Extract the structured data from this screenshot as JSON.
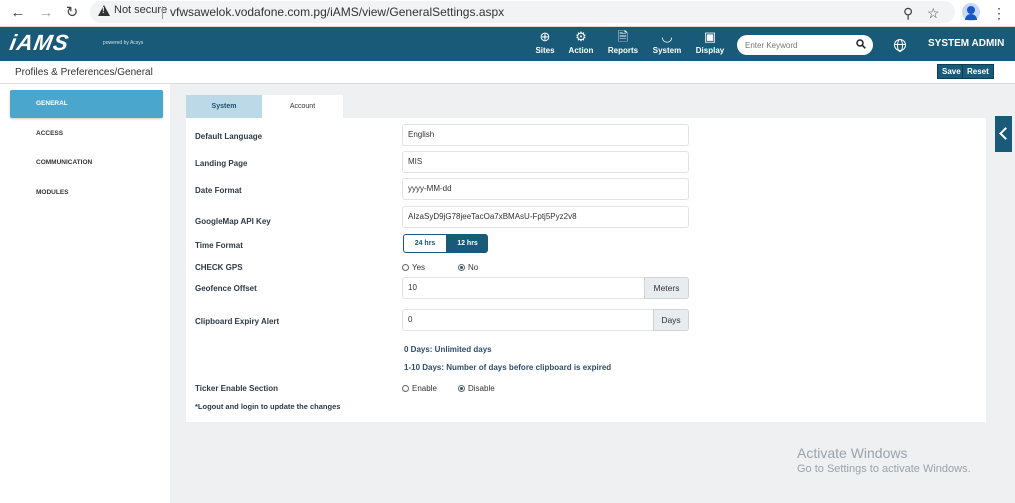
{
  "browser": {
    "security_label": "Not secure",
    "url": "vfwsawelok.vodafone.com.pg/iAMS/view/GeneralSettings.aspx"
  },
  "header": {
    "logo_text": "iAMS",
    "logo_sub": "powered by Acsys",
    "nav": [
      {
        "label": "Sites",
        "icon": "tower-icon"
      },
      {
        "label": "Action",
        "icon": "gear-icon"
      },
      {
        "label": "Reports",
        "icon": "document-icon"
      },
      {
        "label": "System",
        "icon": "gauge-icon"
      },
      {
        "label": "Display",
        "icon": "monitor-icon"
      }
    ],
    "search_placeholder": "Enter Keyword",
    "user": "SYSTEM ADMIN"
  },
  "page": {
    "breadcrumb": "Profiles & Preferences/General",
    "save_label": "Save",
    "reset_label": "Reset"
  },
  "sidebar": {
    "items": [
      {
        "label": "GENERAL",
        "active": true
      },
      {
        "label": "ACCESS",
        "active": false
      },
      {
        "label": "COMMUNICATION",
        "active": false
      },
      {
        "label": "MODULES",
        "active": false
      }
    ]
  },
  "tabs": {
    "system": "System",
    "account": "Account"
  },
  "form": {
    "default_language": {
      "label": "Default Language",
      "value": "English"
    },
    "landing_page": {
      "label": "Landing Page",
      "value": "MIS"
    },
    "date_format": {
      "label": "Date Format",
      "value": "yyyy-MM-dd"
    },
    "googlemap_key": {
      "label": "GoogleMap API Key",
      "value": "AIzaSyD9jG78jeeTacOa7xBMAsU-Fptj5Pyz2v8"
    },
    "time_format": {
      "label": "Time Format",
      "option_24": "24 hrs",
      "option_12": "12 hrs",
      "selected": "12 hrs"
    },
    "check_gps": {
      "label": "CHECK GPS",
      "yes": "Yes",
      "no": "No",
      "selected": "No"
    },
    "geofence_offset": {
      "label": "Geofence Offset",
      "value": "10",
      "unit": "Meters"
    },
    "clipboard_expiry": {
      "label": "Clipboard Expiry Alert",
      "value": "0",
      "unit": "Days"
    },
    "info_line1": "0 Days: Unlimited days",
    "info_line2": "1-10 Days: Number of days before clipboard is expired",
    "ticker": {
      "label": "Ticker Enable Section",
      "enable": "Enable",
      "disable": "Disable",
      "selected": "Disable"
    },
    "note": "*Logout and login to update the changes"
  },
  "watermark": {
    "line1": "Activate Windows",
    "line2": "Go to Settings to activate Windows."
  }
}
